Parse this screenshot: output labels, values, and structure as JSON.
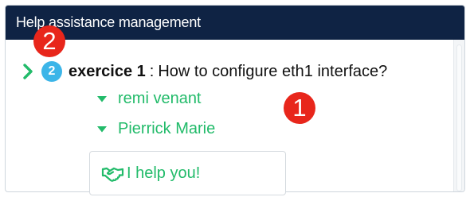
{
  "panel": {
    "title": "Help assistance management"
  },
  "markers": {
    "first": "1",
    "second": "2"
  },
  "item": {
    "count": "2",
    "title": "exercice 1",
    "separator": ":",
    "question": "How to configure eth1 interface?",
    "expand_icon": "chevron-right-icon"
  },
  "helpers": [
    {
      "name": "remi venant",
      "icon": "caret-down-icon"
    },
    {
      "name": "Pierrick Marie",
      "icon": "caret-down-icon"
    }
  ],
  "help_button": {
    "label": "I help you!",
    "icon": "handshake-icon"
  },
  "colors": {
    "header_bg": "#0f2344",
    "accent_green": "#22bb6a",
    "badge_blue": "#3cb5e8",
    "marker_red": "#e8261b"
  }
}
